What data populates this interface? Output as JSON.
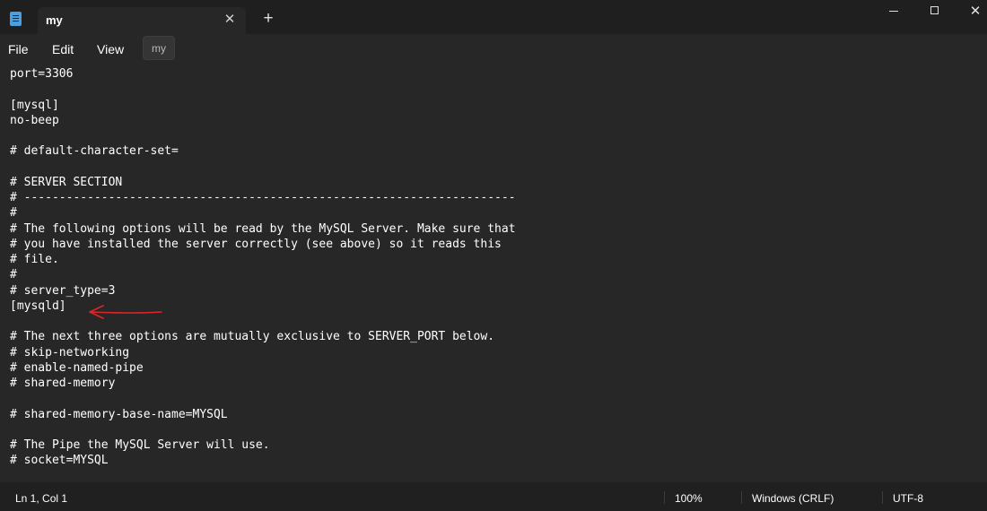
{
  "tab": {
    "title": "my",
    "close_glyph": "✕",
    "new_tab_glyph": "+"
  },
  "window_controls": {
    "close_glyph": "✕"
  },
  "menu": {
    "file": "File",
    "edit": "Edit",
    "view": "View",
    "tooltip": "my"
  },
  "editor": {
    "lines": [
      "port=3306",
      "",
      "[mysql]",
      "no-beep",
      "",
      "# default-character-set=",
      "",
      "# SERVER SECTION",
      "# ----------------------------------------------------------------------",
      "#",
      "# The following options will be read by the MySQL Server. Make sure that",
      "# you have installed the server correctly (see above) so it reads this",
      "# file.",
      "#",
      "# server_type=3",
      "[mysqld]",
      "",
      "# The next three options are mutually exclusive to SERVER_PORT below.",
      "# skip-networking",
      "# enable-named-pipe",
      "# shared-memory",
      "",
      "# shared-memory-base-name=MYSQL",
      "",
      "# The Pipe the MySQL Server will use.",
      "# socket=MYSQL"
    ],
    "annotation_color": "#d9262b"
  },
  "status": {
    "position": "Ln 1, Col 1",
    "zoom": "100%",
    "line_ending": "Windows (CRLF)",
    "encoding": "UTF-8"
  },
  "icons": {
    "app": "notepad-icon",
    "settings": "gear-icon"
  }
}
